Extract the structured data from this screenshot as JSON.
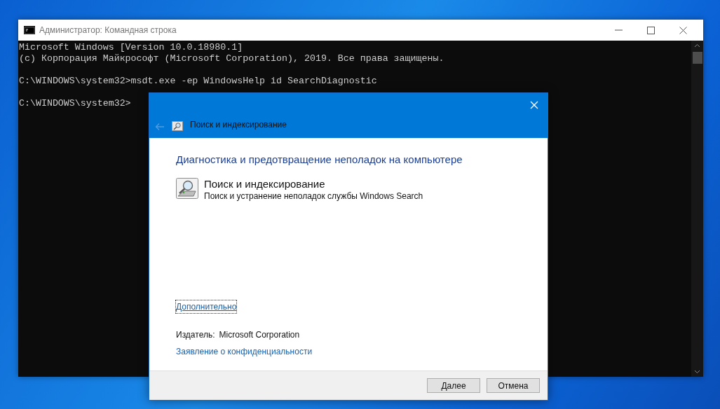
{
  "console_window": {
    "title": "Администратор: Командная строка",
    "blocks": [
      [
        "Microsoft Windows [Version 10.0.18980.1]",
        "(c) Корпорация Майкрософт (Microsoft Corporation), 2019. Все права защищены."
      ],
      [
        "C:\\WINDOWS\\system32>msdt.exe -ep WindowsHelp id SearchDiagnostic"
      ],
      [
        "C:\\WINDOWS\\system32>"
      ]
    ]
  },
  "dialog": {
    "title": "Поиск и индексирование",
    "back_disabled": true,
    "heading": "Диагностика и предотвращение неполадок на компьютере",
    "item": {
      "title": "Поиск и индексирование",
      "description": "Поиск и устранение неполадок службы Windows Search"
    },
    "advanced_link": {
      "label": "Дополнительно",
      "focused": true
    },
    "publisher_label": "Издатель:",
    "publisher": "Microsoft Corporation",
    "privacy_link": "Заявление о конфиденциальности",
    "buttons": [
      {
        "label": "Далее"
      },
      {
        "label": "Отмена"
      }
    ]
  }
}
